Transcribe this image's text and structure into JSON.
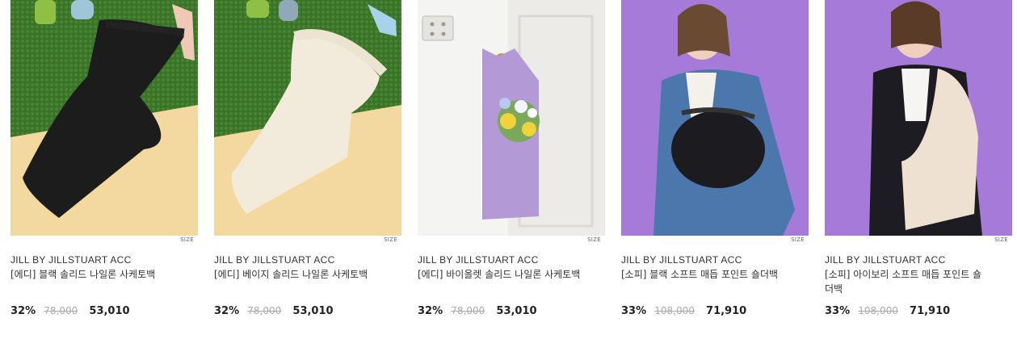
{
  "products": [
    {
      "brand": "JILL BY JILLSTUART ACC",
      "name": "[에디] 블랙 솔리드 나일론 사케토백",
      "discount": "32%",
      "original_price": "78,000",
      "sale_price": "53,010",
      "size_label": "SIZE"
    },
    {
      "brand": "JILL BY JILLSTUART ACC",
      "name": "[에디] 베이지 솔리드 나일론 사케토백",
      "discount": "32%",
      "original_price": "78,000",
      "sale_price": "53,010",
      "size_label": "SIZE"
    },
    {
      "brand": "JILL BY JILLSTUART ACC",
      "name": "[에디] 바이올렛 솔리드 나일론 사케토백",
      "discount": "32%",
      "original_price": "78,000",
      "sale_price": "53,010",
      "size_label": "SIZE"
    },
    {
      "brand": "JILL BY JILLSTUART ACC",
      "name": "[소피] 블랙 소프트 매듭 포인트 숄더백",
      "discount": "33%",
      "original_price": "108,000",
      "sale_price": "71,910",
      "size_label": "SIZE"
    },
    {
      "brand": "JILL BY JILLSTUART ACC",
      "name": "[소피] 아이보리 소프트 매듭 포인트 숄더백",
      "discount": "33%",
      "original_price": "108,000",
      "sale_price": "71,910",
      "size_label": "SIZE"
    }
  ]
}
